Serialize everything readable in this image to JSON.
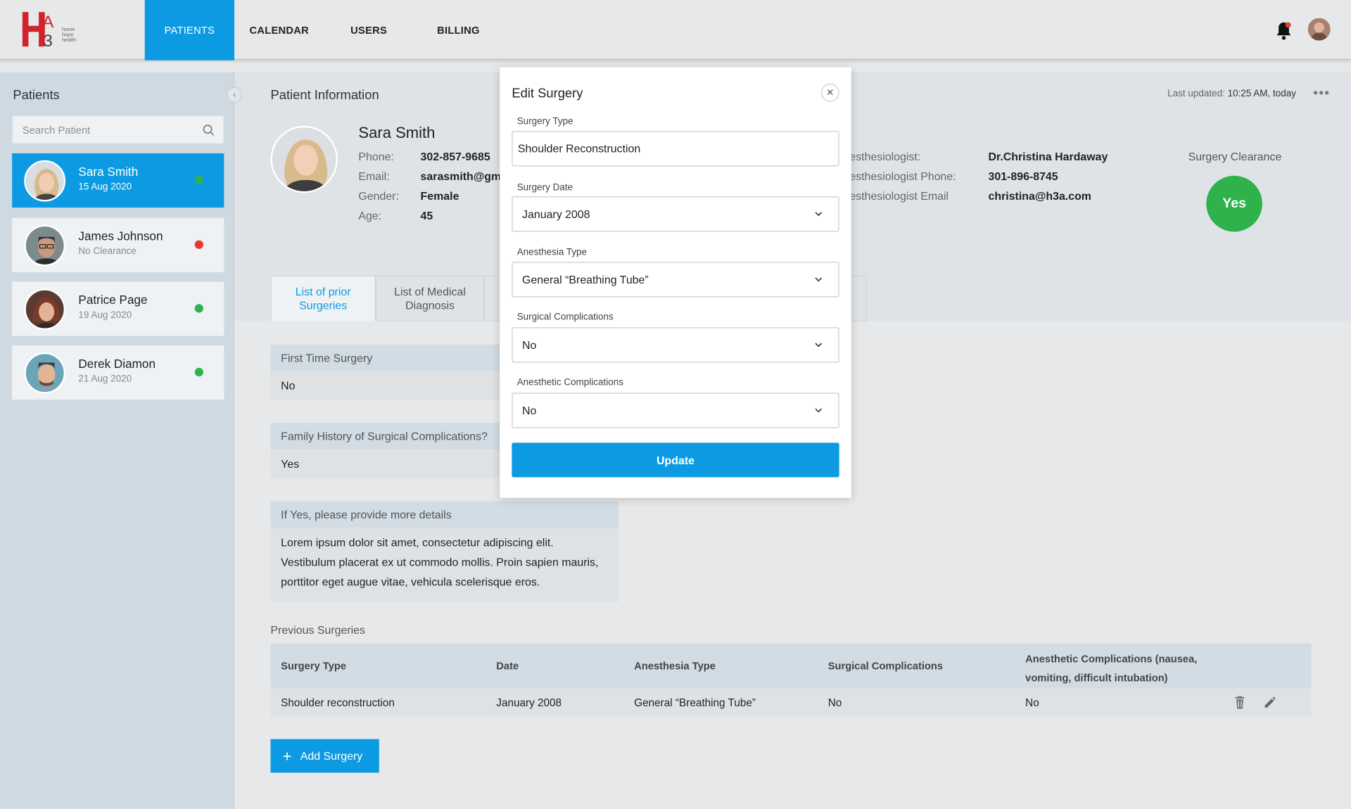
{
  "nav": {
    "logo_text": "home hope health",
    "items": [
      {
        "label": "PATIENTS"
      },
      {
        "label": "CALENDAR"
      },
      {
        "label": "USERS"
      },
      {
        "label": "BILLING"
      }
    ]
  },
  "sidebar": {
    "title": "Patients",
    "search_placeholder": "Search Patient",
    "patients": [
      {
        "name": "Sara Smith",
        "sub": "15 Aug 2020",
        "status_color": "#2fb24c"
      },
      {
        "name": "James Johnson",
        "sub": "No Clearance",
        "status_color": "#e53a2f"
      },
      {
        "name": "Patrice Page",
        "sub": "19 Aug 2020",
        "status_color": "#2fb24c"
      },
      {
        "name": "Derek Diamon",
        "sub": "21 Aug 2020",
        "status_color": "#2fb24c"
      }
    ]
  },
  "patient_info": {
    "title": "Patient Information",
    "last_updated_label": "Last updated:",
    "last_updated_value": "10:25 AM, today",
    "name": "Sara Smith",
    "phone_label": "Phone:",
    "phone": "302-857-9685",
    "email_label": "Email:",
    "email": "sarasmith@gma",
    "gender_label": "Gender:",
    "gender": "Female",
    "age_label": "Age:",
    "age": "45",
    "anesth_label": "esthesiologist:",
    "anesth": "Dr.Christina Hardaway",
    "anesth_phone_label": "esthesiologist Phone:",
    "anesth_phone": "301-896-8745",
    "anesth_email_label": "esthesiologist Email",
    "anesth_email": "christina@h3a.com",
    "clearance_label": "Surgery Clearance",
    "clearance_value": "Yes"
  },
  "tabs": [
    {
      "label": "List of prior Surgeries"
    },
    {
      "label": "List of Medical Diagnosis"
    }
  ],
  "form": {
    "first_time_label": "First Time Surgery",
    "first_time_value": "No",
    "family_label": "Family History of Surgical Complications?",
    "family_value": "Yes",
    "details_label": "If Yes, please provide more details",
    "details_value": "Lorem ipsum dolor sit amet, consectetur adipiscing elit. Vestibulum placerat ex ut commodo mollis. Proin sapien mauris, porttitor eget augue vitae, vehicula scelerisque eros."
  },
  "previous_surgeries": {
    "title": "Previous Surgeries",
    "headers": [
      "Surgery Type",
      "Date",
      "Anesthesia Type",
      "Surgical Complications",
      "Anesthetic Complications (nausea, vomiting, difficult intubation)"
    ],
    "rows": [
      [
        "Shoulder reconstruction",
        "January 2008",
        "General “Breathing Tube”",
        "No",
        "No"
      ]
    ],
    "add_label": "Add Surgery"
  },
  "modal": {
    "title": "Edit Surgery",
    "surgery_type_label": "Surgery Type",
    "surgery_type_value": "Shoulder Reconstruction",
    "surgery_date_label": "Surgery Date",
    "surgery_date_value": "January 2008",
    "anesthesia_type_label": "Anesthesia Type",
    "anesthesia_type_value": "General “Breathing Tube”",
    "surgical_comp_label": "Surgical Complications",
    "surgical_comp_value": "No",
    "anesthetic_comp_label": "Anesthetic Complications",
    "anesthetic_comp_value": "No",
    "update_label": "Update"
  },
  "colors": {
    "accent": "#0c9be2",
    "ok": "#2fb24c",
    "alert": "#e53a2f"
  }
}
